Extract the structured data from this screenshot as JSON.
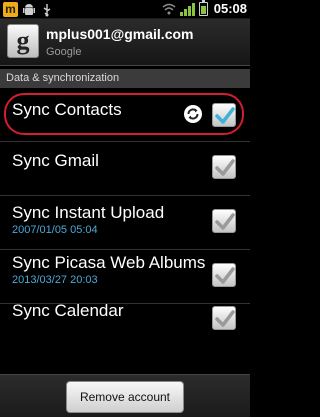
{
  "status_bar": {
    "app_icon_letter": "m",
    "time": "05:08",
    "battery_level": 0.7,
    "signal_bars": 4,
    "icons": [
      "m-app-icon",
      "android-icon",
      "usb-icon",
      "wifi-icon",
      "signal-icon",
      "battery-icon"
    ]
  },
  "account": {
    "logo_letter": "g",
    "email": "mplus001@gmail.com",
    "type": "Google"
  },
  "section": {
    "title": "Data & synchronization"
  },
  "sync_items": [
    {
      "title": "Sync Contacts",
      "subtitle": "",
      "checked": true,
      "syncing": true
    },
    {
      "title": "Sync Gmail",
      "subtitle": "",
      "checked": true,
      "syncing": false
    },
    {
      "title": "Sync Instant Upload",
      "subtitle": "2007/01/05 05:04",
      "checked": true,
      "syncing": false
    },
    {
      "title": "Sync Picasa Web Albums",
      "subtitle": "2013/03/27 20:03",
      "checked": true,
      "syncing": false
    },
    {
      "title": "Sync Calendar",
      "subtitle": "",
      "checked": true,
      "syncing": false
    }
  ],
  "bottom": {
    "remove_label": "Remove account"
  },
  "colors": {
    "highlight": "#d21e2e",
    "check_active": "#3fb2d6",
    "check_inactive": "#9a9a9a",
    "subtitle": "#4aa9d6",
    "app_icon": "#f2a91c",
    "signal": "#8ac43c"
  }
}
